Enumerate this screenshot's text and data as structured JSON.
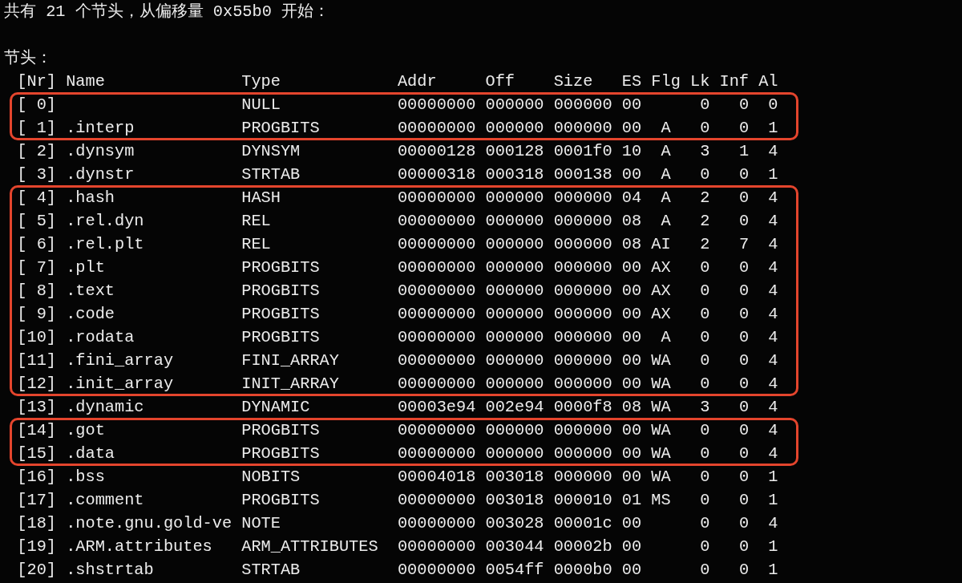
{
  "intro": "共有 21 个节头，从偏移量 0x55b0 开始：",
  "section_label": "节头：",
  "columns": [
    "[Nr]",
    "Name",
    "Type",
    "Addr",
    "Off",
    "Size",
    "ES",
    "Flg",
    "Lk",
    "Inf",
    "Al"
  ],
  "blocks": [
    {
      "boxed": true,
      "rows": [
        {
          "nr": "[ 0]",
          "type": "NULL",
          "addr": "00000000",
          "off": "000000",
          "size": "000000",
          "es": "00",
          "lk": "0",
          "inf": "0",
          "al": "0"
        },
        {
          "nr": "[ 1]",
          "name": ".interp",
          "type": "PROGBITS",
          "addr": "00000000",
          "off": "000000",
          "size": "000000",
          "es": "00",
          "flg": "A",
          "lk": "0",
          "inf": "0",
          "al": "1"
        }
      ]
    },
    {
      "boxed": false,
      "rows": [
        {
          "nr": "[ 2]",
          "name": ".dynsym",
          "type": "DYNSYM",
          "addr": "00000128",
          "off": "000128",
          "size": "0001f0",
          "es": "10",
          "flg": "A",
          "lk": "3",
          "inf": "1",
          "al": "4"
        },
        {
          "nr": "[ 3]",
          "name": ".dynstr",
          "type": "STRTAB",
          "addr": "00000318",
          "off": "000318",
          "size": "000138",
          "es": "00",
          "flg": "A",
          "lk": "0",
          "inf": "0",
          "al": "1"
        }
      ]
    },
    {
      "boxed": true,
      "rows": [
        {
          "nr": "[ 4]",
          "name": ".hash",
          "type": "HASH",
          "addr": "00000000",
          "off": "000000",
          "size": "000000",
          "es": "04",
          "flg": "A",
          "lk": "2",
          "inf": "0",
          "al": "4"
        },
        {
          "nr": "[ 5]",
          "name": ".rel.dyn",
          "type": "REL",
          "addr": "00000000",
          "off": "000000",
          "size": "000000",
          "es": "08",
          "flg": "A",
          "lk": "2",
          "inf": "0",
          "al": "4"
        },
        {
          "nr": "[ 6]",
          "name": ".rel.plt",
          "type": "REL",
          "addr": "00000000",
          "off": "000000",
          "size": "000000",
          "es": "08",
          "flg": "AI",
          "lk": "2",
          "inf": "7",
          "al": "4"
        },
        {
          "nr": "[ 7]",
          "name": ".plt",
          "type": "PROGBITS",
          "addr": "00000000",
          "off": "000000",
          "size": "000000",
          "es": "00",
          "flg": "AX",
          "lk": "0",
          "inf": "0",
          "al": "4"
        },
        {
          "nr": "[ 8]",
          "name": ".text",
          "type": "PROGBITS",
          "addr": "00000000",
          "off": "000000",
          "size": "000000",
          "es": "00",
          "flg": "AX",
          "lk": "0",
          "inf": "0",
          "al": "4"
        },
        {
          "nr": "[ 9]",
          "name": ".code",
          "type": "PROGBITS",
          "addr": "00000000",
          "off": "000000",
          "size": "000000",
          "es": "00",
          "flg": "AX",
          "lk": "0",
          "inf": "0",
          "al": "4"
        },
        {
          "nr": "[10]",
          "name": ".rodata",
          "type": "PROGBITS",
          "addr": "00000000",
          "off": "000000",
          "size": "000000",
          "es": "00",
          "flg": "A",
          "lk": "0",
          "inf": "0",
          "al": "4"
        },
        {
          "nr": "[11]",
          "name": ".fini_array",
          "type": "FINI_ARRAY",
          "addr": "00000000",
          "off": "000000",
          "size": "000000",
          "es": "00",
          "flg": "WA",
          "lk": "0",
          "inf": "0",
          "al": "4"
        },
        {
          "nr": "[12]",
          "name": ".init_array",
          "type": "INIT_ARRAY",
          "addr": "00000000",
          "off": "000000",
          "size": "000000",
          "es": "00",
          "flg": "WA",
          "lk": "0",
          "inf": "0",
          "al": "4"
        }
      ]
    },
    {
      "boxed": false,
      "rows": [
        {
          "nr": "[13]",
          "name": ".dynamic",
          "type": "DYNAMIC",
          "addr": "00003e94",
          "off": "002e94",
          "size": "0000f8",
          "es": "08",
          "flg": "WA",
          "lk": "3",
          "inf": "0",
          "al": "4"
        }
      ]
    },
    {
      "boxed": true,
      "rows": [
        {
          "nr": "[14]",
          "name": ".got",
          "type": "PROGBITS",
          "addr": "00000000",
          "off": "000000",
          "size": "000000",
          "es": "00",
          "flg": "WA",
          "lk": "0",
          "inf": "0",
          "al": "4"
        },
        {
          "nr": "[15]",
          "name": ".data",
          "type": "PROGBITS",
          "addr": "00000000",
          "off": "000000",
          "size": "000000",
          "es": "00",
          "flg": "WA",
          "lk": "0",
          "inf": "0",
          "al": "4"
        }
      ]
    },
    {
      "boxed": false,
      "rows": [
        {
          "nr": "[16]",
          "name": ".bss",
          "type": "NOBITS",
          "addr": "00004018",
          "off": "003018",
          "size": "000000",
          "es": "00",
          "flg": "WA",
          "lk": "0",
          "inf": "0",
          "al": "1"
        },
        {
          "nr": "[17]",
          "name": ".comment",
          "type": "PROGBITS",
          "addr": "00000000",
          "off": "003018",
          "size": "000010",
          "es": "01",
          "flg": "MS",
          "lk": "0",
          "inf": "0",
          "al": "1"
        },
        {
          "nr": "[18]",
          "name": ".note.gnu.gold-ve",
          "type": "NOTE",
          "addr": "00000000",
          "off": "003028",
          "size": "00001c",
          "es": "00",
          "lk": "0",
          "inf": "0",
          "al": "4"
        },
        {
          "nr": "[19]",
          "name": ".ARM.attributes",
          "type": "ARM_ATTRIBUTES",
          "addr": "00000000",
          "off": "003044",
          "size": "00002b",
          "es": "00",
          "lk": "0",
          "inf": "0",
          "al": "1"
        },
        {
          "nr": "[20]",
          "name": ".shstrtab",
          "type": "STRTAB",
          "addr": "00000000",
          "off": "0054ff",
          "size": "0000b0",
          "es": "00",
          "lk": "0",
          "inf": "0",
          "al": "1"
        }
      ]
    }
  ]
}
